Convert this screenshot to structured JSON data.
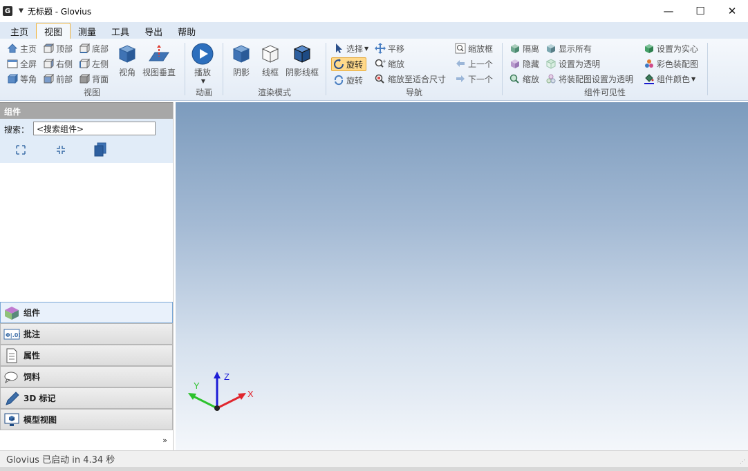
{
  "window": {
    "app_icon": "G",
    "title": "无标题 - Glovius",
    "minimize": "—",
    "maximize": "☐",
    "close": "✕"
  },
  "tabs": [
    {
      "label": "主页",
      "active": false
    },
    {
      "label": "视图",
      "active": true
    },
    {
      "label": "测量",
      "active": false
    },
    {
      "label": "工具",
      "active": false
    },
    {
      "label": "导出",
      "active": false
    },
    {
      "label": "帮助",
      "active": false
    }
  ],
  "ribbon": {
    "view_group": {
      "label": "视图",
      "home": "主页",
      "top": "顶部",
      "bottom": "底部",
      "fullscreen": "全屏",
      "right": "右侧",
      "left": "左侧",
      "iso": "等角",
      "front": "前部",
      "back": "背面",
      "viewpoint": "视角",
      "perpendicular": "视图垂直"
    },
    "animation_group": {
      "label": "动画",
      "play": "播放"
    },
    "render_group": {
      "label": "渲染模式",
      "shaded": "阴影",
      "wireframe": "线框",
      "shaded_wire": "阴影线框"
    },
    "nav_group": {
      "label": "导航",
      "select": "选择",
      "rotate_active": "旋转",
      "rotate": "旋转",
      "pan": "平移",
      "zoom": "缩放",
      "zoom_fit": "缩放至适合尺寸",
      "zoom_box": "缩放框",
      "prev": "上一个",
      "next": "下一个"
    },
    "visibility_group": {
      "label": "组件可见性",
      "isolate": "隔离",
      "hide": "隐藏",
      "zoom": "缩放",
      "show_all": "显示所有",
      "set_transparent": "设置为透明",
      "set_assembly_transparent": "将装配图设置为透明",
      "set_solid": "设置为实心",
      "color_assembly": "彩色装配图",
      "component_color": "组件颜色"
    }
  },
  "left_panel": {
    "header": "组件",
    "search_label": "搜索：",
    "search_value": "<搜索组件>",
    "nav_items": [
      {
        "label": "组件",
        "icon": "component-icon",
        "active": true
      },
      {
        "label": "批注",
        "icon": "annotation-icon",
        "active": false
      },
      {
        "label": "属性",
        "icon": "properties-icon",
        "active": false
      },
      {
        "label": "饲料",
        "icon": "comment-icon",
        "active": false
      },
      {
        "label": "3D 标记",
        "icon": "pen-icon",
        "active": false
      },
      {
        "label": "模型视图",
        "icon": "model-view-icon",
        "active": false
      }
    ],
    "more": "»"
  },
  "axes": {
    "x": "X",
    "y": "Y",
    "z": "Z",
    "x_color": "#e0262e",
    "y_color": "#2cc22c",
    "z_color": "#1c1cd6"
  },
  "status": {
    "text": "Glovius  已启动 in 4.34 秒"
  }
}
